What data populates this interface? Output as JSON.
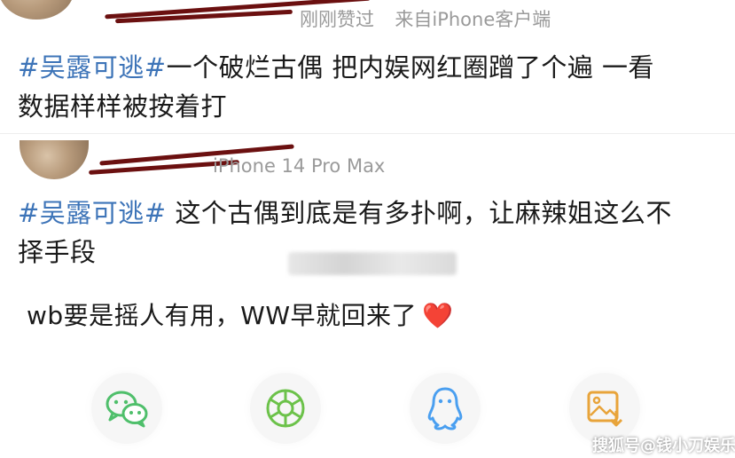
{
  "comment1": {
    "meta_like": "刚刚赞过",
    "meta_source": "来自iPhone客户端",
    "topic": "#吴露可逃#",
    "text_line1": "一个破烂古偶 把内娱网红圈蹭了个遍 一看",
    "text_line2": "数据样样被按着打"
  },
  "comment2": {
    "meta_source": "iPhone 14 Pro Max",
    "topic": "#吴露可逃#",
    "text_line1": " 这个古偶到底是有多扑啊，让麻辣姐这么不",
    "text_line2": "择手段"
  },
  "caption": {
    "text": "wb要是摇人有用，WW早就回来了",
    "emoji": "❤️"
  },
  "share_bar": {
    "items": [
      {
        "icon": "wechat-icon",
        "color": "#4fbf6b"
      },
      {
        "icon": "moments-icon",
        "color": "#6cc24a"
      },
      {
        "icon": "qq-icon",
        "color": "#4a9ff0"
      },
      {
        "icon": "save-image-icon",
        "color": "#e8a43a"
      }
    ]
  },
  "watermark": {
    "text": "搜狐号@钱小刀娱乐"
  }
}
